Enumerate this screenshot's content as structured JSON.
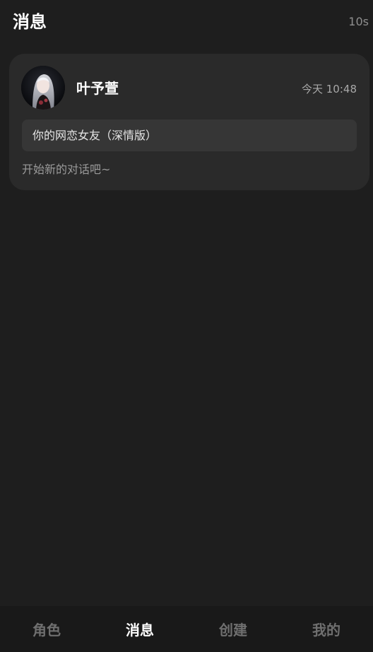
{
  "header": {
    "title": "消息",
    "timer": "10s"
  },
  "conversations": [
    {
      "name": "叶予萱",
      "time": "今天 10:48",
      "tag": "你的网恋女友（深情版）",
      "preview": "开始新的对话吧~",
      "avatar_icon": "character-portrait-avatar"
    }
  ],
  "tabs": [
    {
      "label": "角色",
      "active": false
    },
    {
      "label": "消息",
      "active": true
    },
    {
      "label": "创建",
      "active": false
    },
    {
      "label": "我的",
      "active": false
    }
  ],
  "colors": {
    "background": "#1e1e1e",
    "card": "#2a2a2a",
    "tag_background": "#363636",
    "tabbar": "#191919",
    "active_tab": "#ffffff",
    "inactive_tab": "#6f6f6f"
  }
}
